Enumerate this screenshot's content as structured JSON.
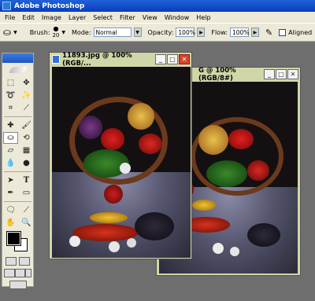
{
  "app": {
    "title": "Adobe Photoshop"
  },
  "menu": [
    "File",
    "Edit",
    "Image",
    "Layer",
    "Select",
    "Filter",
    "View",
    "Window",
    "Help"
  ],
  "options": {
    "brush_label": "Brush:",
    "brush_size": "20",
    "mode_label": "Mode:",
    "mode_value": "Normal",
    "opacity_label": "Opacity:",
    "opacity_value": "100%",
    "flow_label": "Flow:",
    "flow_value": "100%",
    "aligned_label": "Aligned",
    "aligned_checked": false
  },
  "documents": [
    {
      "title": "11893.jpg @ 100% (RGB/..."
    },
    {
      "title": "G @ 100% (RGB/8#)"
    }
  ],
  "tools": [
    "marquee",
    "move",
    "lasso",
    "magic-wand",
    "crop",
    "slice",
    "healing",
    "brush",
    "clone-stamp",
    "history-brush",
    "eraser",
    "gradient",
    "blur",
    "dodge",
    "path-select",
    "type",
    "pen",
    "shape",
    "notes",
    "eyedropper",
    "hand",
    "zoom"
  ],
  "colors": {
    "foreground": "#000000",
    "background": "#ffffff",
    "accent": "#1e62d8"
  }
}
